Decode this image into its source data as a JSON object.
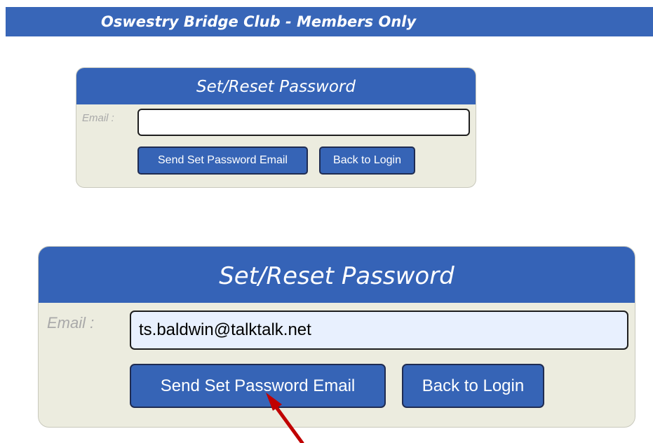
{
  "header": {
    "title": "Oswestry Bridge Club - Members Only"
  },
  "form_small": {
    "title": "Set/Reset Password",
    "email_label": "Email :",
    "email_value": "",
    "send_button": "Send Set Password Email",
    "back_button": "Back to Login"
  },
  "form_large": {
    "title": "Set/Reset Password",
    "email_label": "Email :",
    "email_value": "ts.baldwin@talktalk.net",
    "send_button": "Send Set Password Email",
    "back_button": "Back to Login"
  },
  "colors": {
    "header_bg": "#3866b8",
    "panel_bg": "#ececdf",
    "button_bg": "#3664b6",
    "arrow": "#c00000"
  }
}
